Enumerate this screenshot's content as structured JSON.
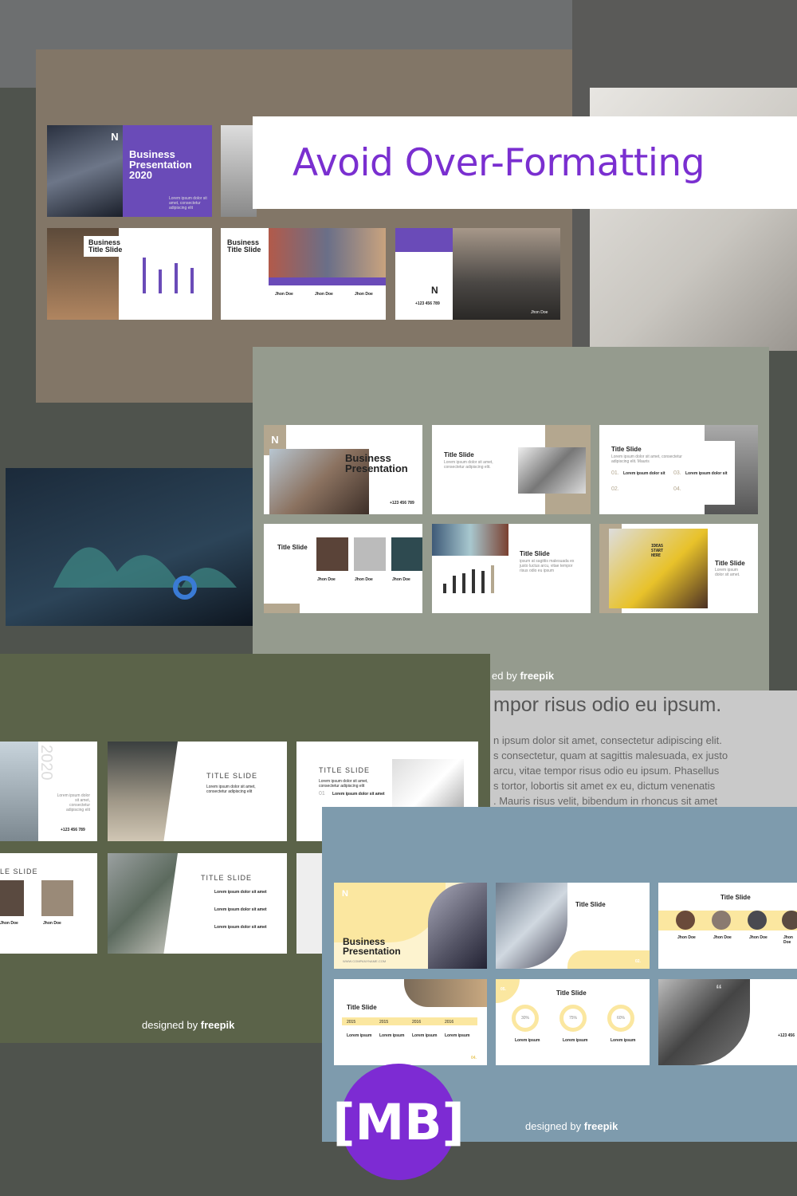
{
  "headline": "Avoid Over-Formatting",
  "logo": {
    "text": "[MB]",
    "color": "#7d2bd3"
  },
  "colors": {
    "accent": "#7a2fd0",
    "panel1": "#827667",
    "panel2": "#959b8e",
    "panel3": "#5b6349",
    "panel4": "#7e9bad",
    "purple_slide": "#6a4bb8",
    "yellow_slide": "#fbe7a0"
  },
  "panel1": {
    "cover": {
      "logo": "N",
      "title": "Business Presentation 2020",
      "text": "Lorem ipsum dolor sit amet, consectetur adipiscing elit"
    },
    "slide2": {
      "title": "Business Title Slide"
    },
    "slide3": {
      "title": "Business Title Slide"
    },
    "slide4": {
      "logo": "N",
      "phone": "+123 456 789",
      "name": "Jhon Doe"
    },
    "team_names": [
      "Jhon Doe",
      "Jhon Doe",
      "Jhon Doe"
    ]
  },
  "panel2": {
    "cover": {
      "logo": "N",
      "title": "Business Presentation",
      "phone": "+123 456 789"
    },
    "slides": [
      {
        "title": "Title Slide",
        "text": "Lorem ipsum dolor sit amet, consectetur adipiscing elit."
      },
      {
        "title": "Title Slide",
        "text": "Lorem ipsum dolor sit amet, consectetur adipiscing elit. Mauris",
        "items": [
          "01.",
          "02.",
          "03.",
          "04."
        ],
        "item_label": "Lorem ipsum dolor sit"
      },
      {
        "title": "Title Slide",
        "names": [
          "Jhon Doe",
          "Jhon Doe",
          "Jhon Doe"
        ]
      },
      {
        "title": "Title Slide",
        "text": "ipsum at sagittis malesuada ex justo luctus arcu, vitae tempor risus odio eu ipsum"
      },
      {
        "logo": "N",
        "title": "Title Slide",
        "text": "Lorem ipsum dolor sit amet.",
        "sign": "IDEAS START HERE"
      }
    ],
    "credit": {
      "prefix": "ed by",
      "brand": "freepik"
    }
  },
  "document": {
    "heading": "mpor risus odio eu ipsum.",
    "lines": [
      "n ipsum dolor sit amet, consectetur adipiscing elit.",
      "s consectetur, quam at sagittis malesuada, ex justo",
      "arcu, vitae tempor risus odio eu ipsum. Phasellus",
      "s tortor, lobortis sit amet ex eu, dictum venenatis",
      ". Mauris risus velit, bibendum in rhoncus sit amet"
    ]
  },
  "panel3": {
    "cover": {
      "year": "2020",
      "text": "Lorem ipsum dolor sit amet, consectetur adipiscing elit",
      "phone": "+123 456 789"
    },
    "slides": [
      {
        "title": "TITLE SLIDE",
        "text": "Lorem ipsum dolor sit amet, consectetur adipiscing elit"
      },
      {
        "title": "TITLE SLIDE",
        "text": "Lorem ipsum dolor sit amet, consectetur adipiscing elit",
        "item": "01",
        "item_label": "Lorem ipsum dolor sit amet"
      },
      {
        "title": "LE SLIDE",
        "names": [
          "Jhon Doe",
          "Jhon Doe"
        ]
      },
      {
        "title": "TITLE SLIDE",
        "items": [
          "Lorem ipsum dolor sit amet",
          "Lorem ipsum dolor sit amet",
          "Lorem ipsum dolor sit amet"
        ]
      }
    ],
    "credit": {
      "prefix": "designed by",
      "brand": "freepik"
    }
  },
  "panel4": {
    "cover": {
      "logo": "N",
      "title": "Business Presentation",
      "url": "WWW.COMPANYNAME.COM"
    },
    "slides": [
      {
        "title": "Title Slide",
        "page": "02."
      },
      {
        "title": "Title Slide",
        "names": [
          "Jhon Doe",
          "Jhon Doe",
          "Jhon Doe",
          "Jhon Doe"
        ]
      },
      {
        "title": "Title Slide",
        "years": [
          "2015",
          "2015",
          "2016",
          "2016"
        ],
        "page": "04.",
        "label": "Lorem ipsum"
      },
      {
        "title": "Title Slide",
        "page": "05.",
        "values": [
          "30%",
          "75%",
          "60%"
        ],
        "label": "Lorem ipsum"
      },
      {
        "phone": "+123 456"
      }
    ],
    "credit": {
      "prefix": "designed by",
      "brand": "freepik"
    }
  }
}
